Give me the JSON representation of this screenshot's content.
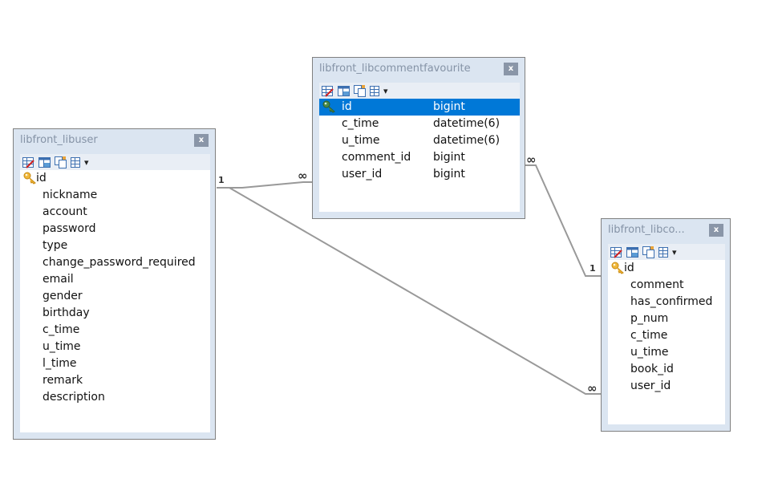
{
  "tables": [
    {
      "id": "libuser",
      "title": "libfront_libuser",
      "close_label": "x",
      "fields": [
        {
          "name": "id",
          "pk": true
        },
        {
          "name": "nickname"
        },
        {
          "name": "account"
        },
        {
          "name": "password"
        },
        {
          "name": "type"
        },
        {
          "name": "change_password_required"
        },
        {
          "name": "email"
        },
        {
          "name": "gender"
        },
        {
          "name": "birthday"
        },
        {
          "name": "c_time"
        },
        {
          "name": "u_time"
        },
        {
          "name": "l_time"
        },
        {
          "name": "remark"
        },
        {
          "name": "description"
        }
      ]
    },
    {
      "id": "libcommentfavourite",
      "title": "libfront_libcommentfavourite",
      "close_label": "x",
      "fields": [
        {
          "name": "id",
          "type": "bigint",
          "pk": true,
          "selected": true
        },
        {
          "name": "c_time",
          "type": "datetime(6)"
        },
        {
          "name": "u_time",
          "type": "datetime(6)"
        },
        {
          "name": "comment_id",
          "type": "bigint"
        },
        {
          "name": "user_id",
          "type": "bigint"
        }
      ]
    },
    {
      "id": "libcomment",
      "title": "libfront_libco...",
      "close_label": "x",
      "fields": [
        {
          "name": "id",
          "pk": true
        },
        {
          "name": "comment"
        },
        {
          "name": "has_confirmed"
        },
        {
          "name": "p_num"
        },
        {
          "name": "c_time"
        },
        {
          "name": "u_time"
        },
        {
          "name": "book_id"
        },
        {
          "name": "user_id"
        }
      ]
    }
  ],
  "relationships": [
    {
      "from": "libuser",
      "to": "libcommentfavourite",
      "from_card": "1",
      "to_card": "∞"
    },
    {
      "from": "libcomment",
      "to": "libcommentfavourite",
      "from_card": "1",
      "to_card": "∞"
    },
    {
      "from": "libuser",
      "to": "libcomment",
      "from_card": "",
      "to_card": "∞"
    }
  ],
  "toolbar_icons": [
    "edit-table-icon",
    "design-table-icon",
    "copy-table-icon",
    "table-menu-icon"
  ],
  "colors": {
    "selected_row": "#0078d7",
    "frame": "#dbe5f1",
    "line": "#999999"
  }
}
